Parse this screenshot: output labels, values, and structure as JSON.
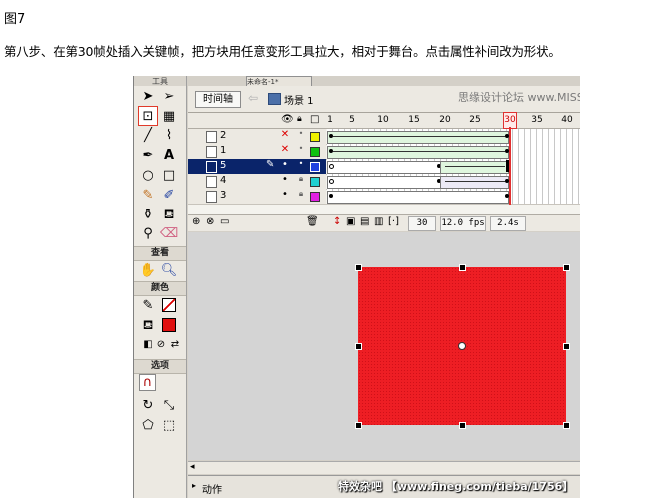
{
  "figure_label": "图7",
  "step_text": "第八步、在第30帧处插入关键帧，把方块用任意变形工具拉大，相对于舞台。点击属性补间改为形状。",
  "doc_tab": "未命名-1*",
  "toolbox": {
    "title": "工具",
    "sections": {
      "view": "查看",
      "colors": "颜色",
      "options": "选项"
    }
  },
  "editbar": {
    "timeline_button": "时间轴",
    "scene": "场景 1",
    "watermark": "思缘设计论坛 www.MISSYUAN.COM"
  },
  "ruler": [
    "1",
    "5",
    "10",
    "15",
    "20",
    "25",
    "30",
    "35",
    "40"
  ],
  "current_frame_marker": "30",
  "layers": [
    {
      "name": "2",
      "selected": false,
      "square_color": "#f0f000",
      "vis": "✕"
    },
    {
      "name": "1",
      "selected": false,
      "square_color": "#10c010",
      "vis": "✕"
    },
    {
      "name": "5",
      "selected": true,
      "square_color": "#2040e0",
      "vis": "•"
    },
    {
      "name": "4",
      "selected": false,
      "square_color": "#20d0d0",
      "vis": "•"
    },
    {
      "name": "3",
      "selected": false,
      "square_color": "#e020e0",
      "vis": "•"
    }
  ],
  "status": {
    "frame": "30",
    "fps": "12.0 fps",
    "time": "2.4s"
  },
  "actions_panel": {
    "label": "动作"
  },
  "tieba_watermark": "特效杂吧 【www.fineg.com/tieba/1756】",
  "colors": {
    "shape_fill": "#ee1e24",
    "selected_layer": "#0a246a",
    "playhead": "#e03030"
  }
}
